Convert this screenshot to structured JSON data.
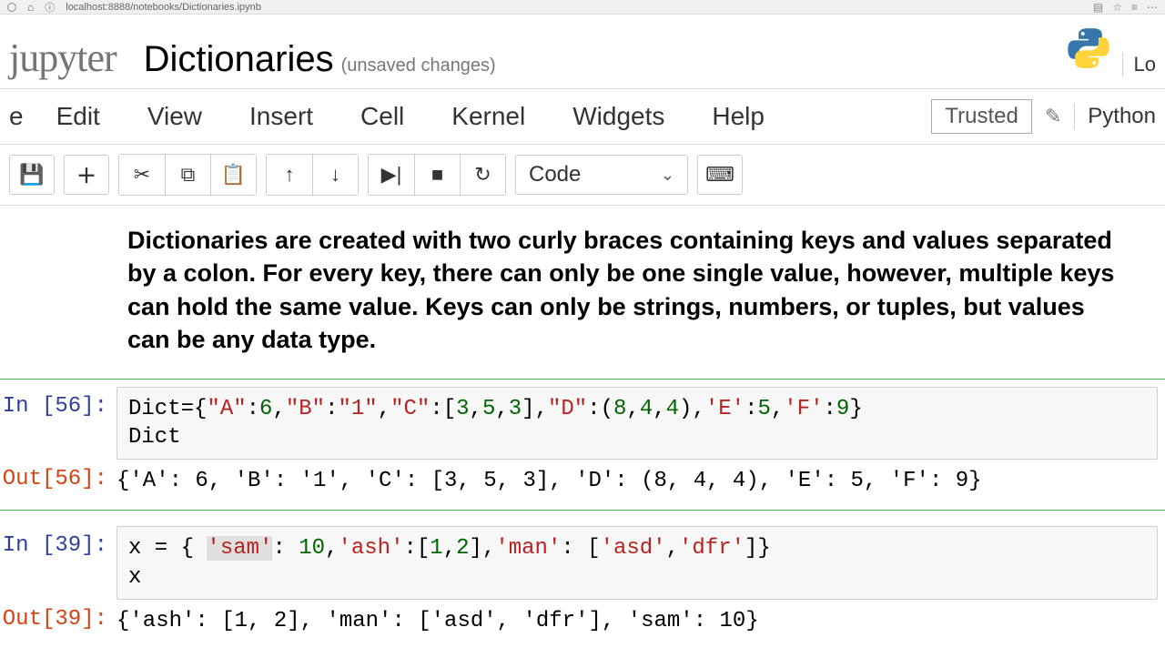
{
  "browser": {
    "url": "localhost:8888/notebooks/Dictionaries.ipynb"
  },
  "header": {
    "logo": "jupyter",
    "notebook_name": "Dictionaries",
    "unsaved": "(unsaved changes)",
    "login": "Lo"
  },
  "menubar": {
    "items": [
      "e",
      "Edit",
      "View",
      "Insert",
      "Cell",
      "Kernel",
      "Widgets",
      "Help"
    ],
    "trusted": "Trusted",
    "kernel": "Python"
  },
  "toolbar": {
    "cell_type": "Code"
  },
  "markdown": "Dictionaries are created with two curly braces containing keys and values separated by a colon. For every key, there can only be one single value, however, multiple keys can hold the same value. Keys can only be strings, numbers, or tuples, but values can be any data type.",
  "cells": [
    {
      "in_prompt": "In [56]:",
      "out_prompt": "Out[56]:",
      "code_tokens": [
        {
          "t": "Dict={",
          "c": ""
        },
        {
          "t": "\"A\"",
          "c": "t-str"
        },
        {
          "t": ":",
          "c": ""
        },
        {
          "t": "6",
          "c": "t-num"
        },
        {
          "t": ",",
          "c": ""
        },
        {
          "t": "\"B\"",
          "c": "t-str"
        },
        {
          "t": ":",
          "c": ""
        },
        {
          "t": "\"1\"",
          "c": "t-str"
        },
        {
          "t": ",",
          "c": ""
        },
        {
          "t": "\"C\"",
          "c": "t-str"
        },
        {
          "t": ":[",
          "c": ""
        },
        {
          "t": "3",
          "c": "t-num"
        },
        {
          "t": ",",
          "c": ""
        },
        {
          "t": "5",
          "c": "t-num"
        },
        {
          "t": ",",
          "c": ""
        },
        {
          "t": "3",
          "c": "t-num"
        },
        {
          "t": "],",
          "c": ""
        },
        {
          "t": "\"D\"",
          "c": "t-str"
        },
        {
          "t": ":(",
          "c": ""
        },
        {
          "t": "8",
          "c": "t-num"
        },
        {
          "t": ",",
          "c": ""
        },
        {
          "t": "4",
          "c": "t-num"
        },
        {
          "t": ",",
          "c": ""
        },
        {
          "t": "4",
          "c": "t-num"
        },
        {
          "t": "),",
          "c": ""
        },
        {
          "t": "'E'",
          "c": "t-str"
        },
        {
          "t": ":",
          "c": ""
        },
        {
          "t": "5",
          "c": "t-num"
        },
        {
          "t": ",",
          "c": ""
        },
        {
          "t": "'F'",
          "c": "t-str"
        },
        {
          "t": ":",
          "c": ""
        },
        {
          "t": "9",
          "c": "t-num"
        },
        {
          "t": "}\nDict",
          "c": ""
        }
      ],
      "output": "{'A': 6, 'B': '1', 'C': [3, 5, 3], 'D': (8, 4, 4), 'E': 5, 'F': 9}"
    },
    {
      "in_prompt": "In [39]:",
      "out_prompt": "Out[39]:",
      "code_tokens": [
        {
          "t": "x = { ",
          "c": ""
        },
        {
          "t": "'sam'",
          "c": "t-str t-hl"
        },
        {
          "t": ": ",
          "c": ""
        },
        {
          "t": "10",
          "c": "t-num"
        },
        {
          "t": ",",
          "c": ""
        },
        {
          "t": "'ash'",
          "c": "t-str"
        },
        {
          "t": ":[",
          "c": ""
        },
        {
          "t": "1",
          "c": "t-num"
        },
        {
          "t": ",",
          "c": ""
        },
        {
          "t": "2",
          "c": "t-num"
        },
        {
          "t": "],",
          "c": ""
        },
        {
          "t": "'man'",
          "c": "t-str"
        },
        {
          "t": ": [",
          "c": ""
        },
        {
          "t": "'asd'",
          "c": "t-str"
        },
        {
          "t": ",",
          "c": ""
        },
        {
          "t": "'dfr'",
          "c": "t-str"
        },
        {
          "t": "]}\nx",
          "c": ""
        }
      ],
      "output": "{'ash': [1, 2], 'man': ['asd', 'dfr'], 'sam': 10}"
    }
  ]
}
